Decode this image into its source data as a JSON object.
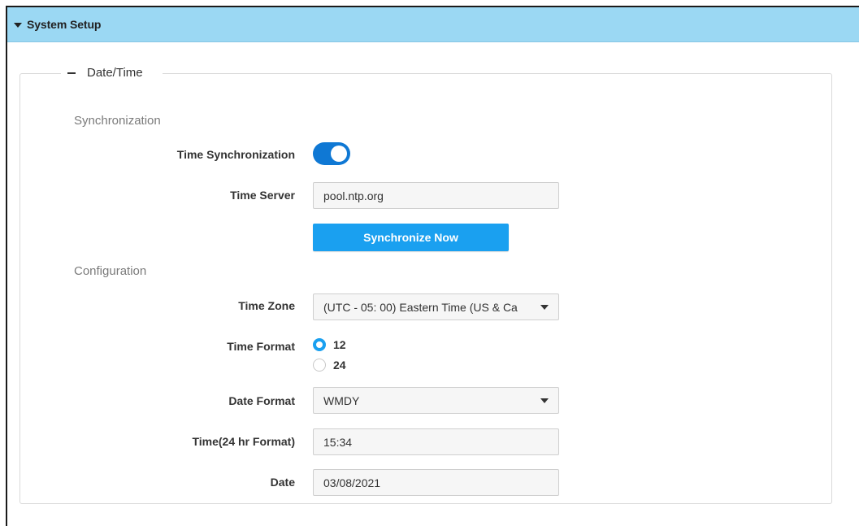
{
  "header": {
    "title": "System Setup"
  },
  "section": {
    "title": "Date/Time"
  },
  "synchronization": {
    "heading": "Synchronization",
    "time_sync_label": "Time Synchronization",
    "time_sync_enabled": true,
    "time_server_label": "Time Server",
    "time_server_value": "pool.ntp.org",
    "sync_button_label": "Synchronize Now"
  },
  "configuration": {
    "heading": "Configuration",
    "time_zone_label": "Time Zone",
    "time_zone_value": "(UTC - 05: 00) Eastern Time (US & Ca",
    "time_format_label": "Time Format",
    "time_format_options": [
      "12",
      "24"
    ],
    "time_format_selected": "12",
    "date_format_label": "Date Format",
    "date_format_value": "WMDY",
    "time_label": "Time(24 hr Format)",
    "time_value": "15:34",
    "date_label": "Date",
    "date_value": "03/08/2021"
  },
  "colors": {
    "header_bg": "#9bd8f3",
    "accent": "#1aa0f0",
    "toggle_on": "#0f78d4"
  },
  "icons": [
    "caret-down-icon",
    "minus-icon",
    "dropdown-arrow-icon"
  ]
}
